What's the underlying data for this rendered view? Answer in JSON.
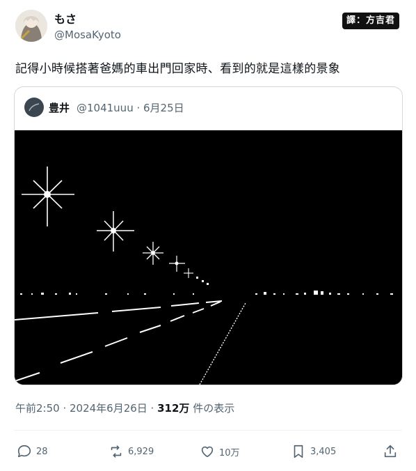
{
  "author": {
    "name": "もさ",
    "handle": "@MosaKyoto"
  },
  "watermark": "譯：方吉君",
  "tweet": {
    "text": "記得小時候搭著爸媽的車出門回家時、看到的就是這樣的景象"
  },
  "quote": {
    "name": "豊井",
    "meta": "@1041uuu · 6月25日"
  },
  "timestamp": {
    "time_date": "午前2:50 · 2024年6月26日 · ",
    "views_count": "312万",
    "views_label": " 件の表示"
  },
  "actions": {
    "replies": "28",
    "reposts": "6,929",
    "likes": "10万",
    "bookmarks": "3,405"
  },
  "colors": {
    "text": "#0f1419",
    "secondary": "#536471",
    "border": "#cfd9de"
  }
}
